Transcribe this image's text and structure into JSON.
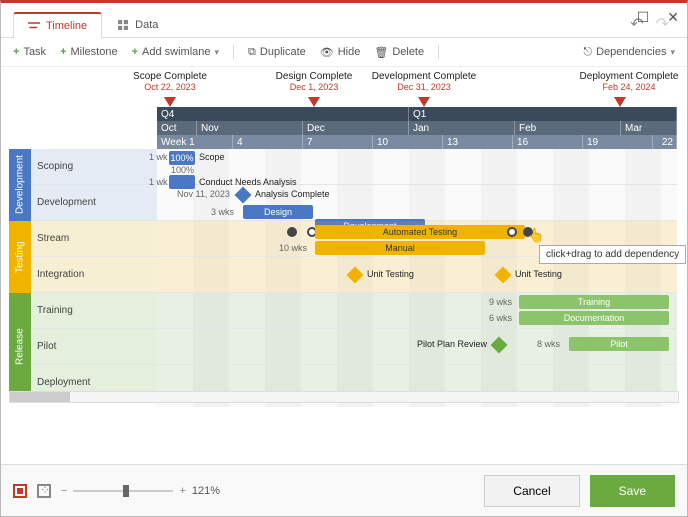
{
  "window": {
    "maximize": "☐",
    "close": "✕"
  },
  "tabs": {
    "timeline": "Timeline",
    "data": "Data"
  },
  "history": {
    "undo": "↶",
    "redo": "↷"
  },
  "toolbar": {
    "task": "Task",
    "milestone": "Milestone",
    "swimlane": "Add swimlane",
    "duplicate": "Duplicate",
    "hide": "Hide",
    "delete": "Delete",
    "deps": "Dependencies"
  },
  "milestones": [
    {
      "name": "Scope Complete",
      "date": "Oct 22, 2023"
    },
    {
      "name": "Design Complete",
      "date": "Dec 1, 2023"
    },
    {
      "name": "Development Complete",
      "date": "Dec 31, 2023"
    },
    {
      "name": "Deployment Complete",
      "date": "Feb 24, 2024"
    }
  ],
  "header": {
    "quarters": [
      "Q4",
      "Q1"
    ],
    "months": [
      "Oct",
      "Nov",
      "Dec",
      "Jan",
      "Feb",
      "Mar"
    ],
    "weeks": [
      "Week 1",
      "4",
      "7",
      "10",
      "13",
      "16",
      "19",
      "22"
    ]
  },
  "phases": {
    "development": {
      "title": "Development",
      "rows": [
        "Scoping",
        "Development"
      ]
    },
    "testing": {
      "title": "Testing",
      "rows": [
        "Stream",
        "Integration"
      ]
    },
    "release": {
      "title": "Release",
      "rows": [
        "Training",
        "Pilot",
        "Deployment"
      ]
    }
  },
  "tasks": {
    "scope": {
      "dur": "1 wk",
      "pct": "100%",
      "label": "Scope"
    },
    "needs": {
      "dur": "1 wk",
      "pct": "100%",
      "label": "Conduct Needs Analysis"
    },
    "analysis_ms": {
      "date": "Nov 11, 2023",
      "label": "Analysis Complete"
    },
    "design": {
      "dur": "3 wks",
      "label": "Design"
    },
    "development": {
      "label": "Development"
    },
    "auto_test": {
      "dur": "10 wks",
      "label": "Automated Testing"
    },
    "manual": {
      "label": "Manual"
    },
    "unit1": {
      "label": "Unit Testing"
    },
    "unit2": {
      "label": "Unit Testing"
    },
    "training": {
      "dur": "9 wks",
      "label": "Training"
    },
    "docs": {
      "dur": "6 wks",
      "label": "Documentation"
    },
    "pilot_review": {
      "label": "Pilot Plan Review"
    },
    "pilot": {
      "dur": "8 wks",
      "label": "Pilot"
    }
  },
  "tooltip": "click+drag to add dependency",
  "zoom": "121%",
  "footer": {
    "cancel": "Cancel",
    "save": "Save"
  },
  "chart_data": {
    "type": "gantt",
    "date_range": [
      "2023-10-01",
      "2024-03-10"
    ],
    "columns": [
      "Oct",
      "Nov",
      "Dec",
      "Jan",
      "Feb",
      "Mar"
    ],
    "phases": [
      {
        "name": "Development",
        "color": "#4a78c4",
        "rows": [
          {
            "name": "Scoping",
            "tasks": [
              {
                "label": "Scope",
                "start": "2023-10-01",
                "weeks": 1,
                "progress": 100
              },
              {
                "label": "Conduct Needs Analysis",
                "start": "2023-10-15",
                "weeks": 1,
                "progress": 100
              },
              {
                "label": "Analysis Complete",
                "type": "milestone",
                "date": "2023-11-11"
              }
            ]
          },
          {
            "name": "Development",
            "tasks": [
              {
                "label": "Design",
                "start": "2023-11-11",
                "weeks": 3
              },
              {
                "label": "Development",
                "start": "2023-12-01",
                "weeks": 4
              }
            ]
          }
        ]
      },
      {
        "name": "Testing",
        "color": "#f0b400",
        "rows": [
          {
            "name": "Stream",
            "tasks": [
              {
                "label": "Automated Testing",
                "start": "2023-12-01",
                "weeks": 10,
                "selected": true
              },
              {
                "label": "Manual",
                "start": "2023-12-08",
                "weeks": 8
              }
            ]
          },
          {
            "name": "Integration",
            "tasks": [
              {
                "label": "Unit Testing",
                "type": "milestone",
                "date": "2023-12-22"
              },
              {
                "label": "Unit Testing",
                "type": "milestone",
                "date": "2024-02-03"
              }
            ]
          }
        ]
      },
      {
        "name": "Release",
        "color": "#6aaa3f",
        "rows": [
          {
            "name": "Training",
            "tasks": [
              {
                "label": "Training",
                "start": "2024-02-01",
                "weeks": 9
              },
              {
                "label": "Documentation",
                "start": "2024-02-01",
                "weeks": 6
              }
            ]
          },
          {
            "name": "Pilot",
            "tasks": [
              {
                "label": "Pilot Plan Review",
                "type": "milestone",
                "date": "2024-01-20"
              },
              {
                "label": "Pilot",
                "start": "2024-02-15",
                "weeks": 8
              }
            ]
          },
          {
            "name": "Deployment",
            "tasks": []
          }
        ]
      }
    ],
    "top_milestones": [
      {
        "name": "Scope Complete",
        "date": "2023-10-22"
      },
      {
        "name": "Design Complete",
        "date": "2023-12-01"
      },
      {
        "name": "Development Complete",
        "date": "2023-12-31"
      },
      {
        "name": "Deployment Complete",
        "date": "2024-02-24"
      }
    ]
  }
}
